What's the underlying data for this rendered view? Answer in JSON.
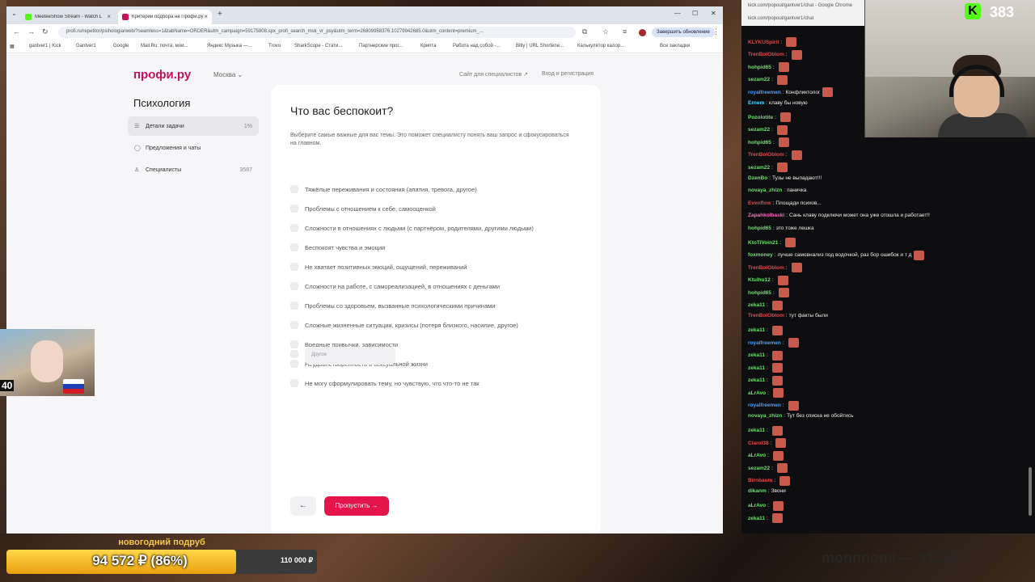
{
  "browser": {
    "tabs": [
      {
        "label": "MeeteeShow Stream - Watch L",
        "color": "#53fc18"
      },
      {
        "label": "Критерии подбора на Профи.ру",
        "color": "#c8105c"
      }
    ],
    "url": "profi.ru/repetitor/psihologia/web/?seamless=1&tabName=ORDER&utm_campaign=59175808.spx_profi_search_msk_vr_psy&utm_term=26809958376.10279942685.0&utm_content=premium_...",
    "update_label": "Завершить обновление",
    "bookmarks": [
      "gantver1 | Kick",
      "Gantver1",
      "Google",
      "Mail.Ru: почта, мои...",
      "Яндекс Музыка —...",
      "Trovo",
      "SharkScope - Стати...",
      "Партнерские прог...",
      "Крипта",
      "Работа над собой -...",
      "Bitly | URL Shortene...",
      "Калькулятор калор...",
      "Все закладки"
    ]
  },
  "site": {
    "logo": "профи.ру",
    "city": "Москва",
    "links": [
      "Сайт для специалистов ↗",
      "Вход и регистрация"
    ],
    "page_title": "Психология",
    "sidebar": [
      {
        "label": "Детали задачи",
        "count": "1%",
        "icon": "list-icon"
      },
      {
        "label": "Предложения и чаты",
        "count": "",
        "icon": "chat-icon"
      },
      {
        "label": "Специалисты",
        "count": "3587",
        "icon": "person-icon"
      }
    ],
    "question": "Что вас беспокоит?",
    "hint": "Выберите самые важные для вас темы. Это поможет специалисту понять ваш запрос и сфокусироваться на главном.",
    "options": [
      "Тяжёлые переживания и состояния (апатия, тревога, другое)",
      "Проблемы с отношением к себе, самооценкой",
      "Сложности в отношениях с людьми (с партнёром, родителями, другими людьми)",
      "Беспокоят чувства и эмоции",
      "Не хватает позитивных эмоций, ощущений, переживаний",
      "Сложности на работе, с самореализацией, в отношениях с деньгами",
      "Проблемы со здоровьем, вызванные психологическими причинами",
      "Сложные жизненные ситуации, кризисы (потеря близкого, насилие, другое)",
      "Вредные привычки, зависимости",
      "Неудовлетворённость в сексуальной жизни",
      "Не могу сформулировать тему, но чувствую, что что-то не так"
    ],
    "other_placeholder": "Другое",
    "back_label": "←",
    "skip_label": "Пропустить →"
  },
  "chat": {
    "url": "kick.com/popout/gantver1/chat",
    "title": "kick.com/popout/gantver1/chat - Google Chrome",
    "messages": [
      {
        "user": "KLYKUSpirit",
        "color": "#e04a4a",
        "text": "",
        "emote": true
      },
      {
        "user": "TrenBolOblom",
        "color": "#e04a4a",
        "text": "",
        "emote": true
      },
      {
        "user": "hohpid65",
        "color": "#6be36b",
        "text": "",
        "emote": true
      },
      {
        "user": "sezam22",
        "color": "#6be36b",
        "text": "",
        "emote": true
      },
      {
        "user": "royalfreemen",
        "color": "#4aa0ff",
        "text": "Конфликтолог",
        "emote": true
      },
      {
        "user": "Ernem",
        "color": "#4ad9ff",
        "text": "клаву бы новую",
        "emote": false
      },
      {
        "user": "Pozolotite",
        "color": "#6be36b",
        "text": "",
        "emote": true
      },
      {
        "user": "sezam22",
        "color": "#6be36b",
        "text": "",
        "emote": true
      },
      {
        "user": "hohpid65",
        "color": "#6be36b",
        "text": "",
        "emote": true
      },
      {
        "user": "TrenBolOblom",
        "color": "#e04a4a",
        "text": "",
        "emote": true
      },
      {
        "user": "sezam22",
        "color": "#6be36b",
        "text": "",
        "emote": true
      },
      {
        "user": "DzenBo",
        "color": "#6be36b",
        "text": "Тузы не выпадают!!!",
        "emote": false
      },
      {
        "user": "novaya_zhizn",
        "color": "#6be36b",
        "text": "паничка",
        "emote": false
      },
      {
        "user": "Evenflow",
        "color": "#e04a4a",
        "text": "Площади психов...",
        "emote": false
      },
      {
        "user": "Zapahkolbaski",
        "color": "#ff6ac1",
        "text": "Сань клаву подключи может она уже отошла и работает!!",
        "emote": false
      },
      {
        "user": "hohpid65",
        "color": "#6be36b",
        "text": "это тоже лешка",
        "emote": false
      },
      {
        "user": "KtoTiVoin21",
        "color": "#6be36b",
        "text": "",
        "emote": true
      },
      {
        "user": "foxmoney",
        "color": "#6be36b",
        "text": "лучше самовнализ под водочкой, раз бор ошибок и т д",
        "emote": true
      },
      {
        "user": "TrenBolOblom",
        "color": "#e04a4a",
        "text": "",
        "emote": true
      },
      {
        "user": "Ktulhu12",
        "color": "#6be36b",
        "text": "",
        "emote": true
      },
      {
        "user": "hohpid65",
        "color": "#6be36b",
        "text": "",
        "emote": true
      },
      {
        "user": "zeka11",
        "color": "#6be36b",
        "text": "",
        "emote": true
      },
      {
        "user": "TrenBolOblom",
        "color": "#e04a4a",
        "text": "тут факты были",
        "emote": false
      },
      {
        "user": "zeka11",
        "color": "#6be36b",
        "text": "",
        "emote": true
      },
      {
        "user": "royalfreemen",
        "color": "#4aa0ff",
        "text": "",
        "emote": true
      },
      {
        "user": "zeka11",
        "color": "#6be36b",
        "text": "",
        "emote": true
      },
      {
        "user": "zeka11",
        "color": "#6be36b",
        "text": "",
        "emote": true
      },
      {
        "user": "zeka11",
        "color": "#6be36b",
        "text": "",
        "emote": true
      },
      {
        "user": "aLrAvo",
        "color": "#6be36b",
        "text": "",
        "emote": true
      },
      {
        "user": "royalfreemen",
        "color": "#4aa0ff",
        "text": "",
        "emote": true
      },
      {
        "user": "novaya_zhizn",
        "color": "#6be36b",
        "text": "Тут без списка не обойтись",
        "emote": false
      },
      {
        "user": "zeka11",
        "color": "#6be36b",
        "text": "",
        "emote": true
      },
      {
        "user": "Ciarol38",
        "color": "#e04a4a",
        "text": "",
        "emote": true
      },
      {
        "user": "aLrAvo",
        "color": "#6be36b",
        "text": "",
        "emote": true
      },
      {
        "user": "sezam22",
        "color": "#6be36b",
        "text": "",
        "emote": true
      },
      {
        "user": "Birnbaum",
        "color": "#e04a4a",
        "text": "",
        "emote": true
      },
      {
        "user": "dikanm",
        "color": "#6be36b",
        "text": "Звони",
        "emote": false
      },
      {
        "user": "aLrAvo",
        "color": "#6be36b",
        "text": "",
        "emote": true
      },
      {
        "user": "zeka11",
        "color": "#6be36b",
        "text": "",
        "emote": true
      }
    ]
  },
  "stream": {
    "viewers": "383",
    "cam_number": "40",
    "donation_title": "новогодний подруб",
    "donation_value": "94 572 ₽ (86%)",
    "donation_goal": "110 000 ₽",
    "donation_progress": 0.86,
    "nickname": "monnnomi — 3111₽"
  }
}
